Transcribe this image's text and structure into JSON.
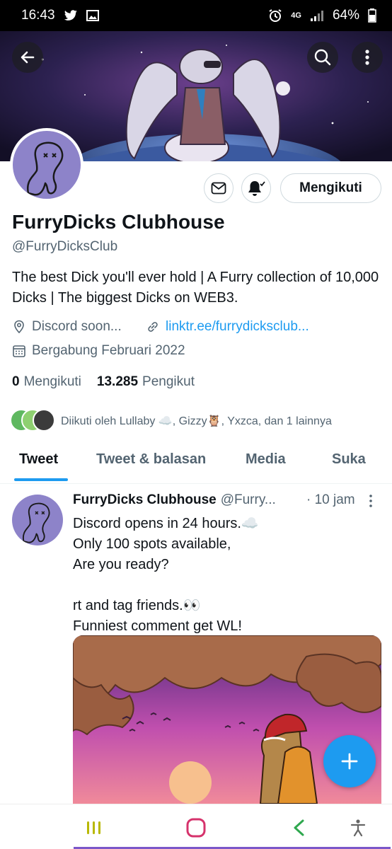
{
  "status_bar": {
    "time": "16:43",
    "network": "4G",
    "battery": "64%"
  },
  "profile": {
    "name": "FurryDicks Clubhouse",
    "handle": "@FurryDicksClub",
    "bio": "The best Dick you'll ever hold | A Furry collection of 10,000 Dicks | The biggest Dicks on WEB3.",
    "location": "Discord soon...",
    "link": "linktr.ee/furrydicksclub...",
    "joined": "Bergabung Februari 2022",
    "following_count": "0",
    "following_label": "Mengikuti",
    "followers_count": "13.285",
    "followers_label": "Pengikut",
    "followed_by": "Diikuti oleh Lullaby ☁️, Gizzy🦉, Yxzca, dan 1 lainnya",
    "follow_button": "Mengikuti"
  },
  "tabs": [
    {
      "label": "Tweet",
      "active": true
    },
    {
      "label": "Tweet & balasan",
      "active": false
    },
    {
      "label": "Media",
      "active": false
    },
    {
      "label": "Suka",
      "active": false
    }
  ],
  "tweet": {
    "name": "FurryDicks Clubhouse",
    "handle": "@Furry...",
    "time": "· 10 jam",
    "text": "Discord opens in 24 hours.☁️\nOnly 100 spots available,\nAre you ready?\n\nrt and tag friends.👀\nFunniest comment get WL!"
  },
  "icons": {
    "back": "back-arrow-icon",
    "search": "search-icon",
    "more": "more-vertical-icon",
    "mail": "mail-icon",
    "bell": "notification-bell-icon",
    "location": "location-pin-icon",
    "link": "link-icon",
    "calendar": "calendar-icon",
    "compose": "plus-icon"
  },
  "colors": {
    "accent": "#1d9bf0",
    "text": "#0f1419",
    "secondary": "#536471",
    "avatar_bg": "#8d83c9"
  }
}
